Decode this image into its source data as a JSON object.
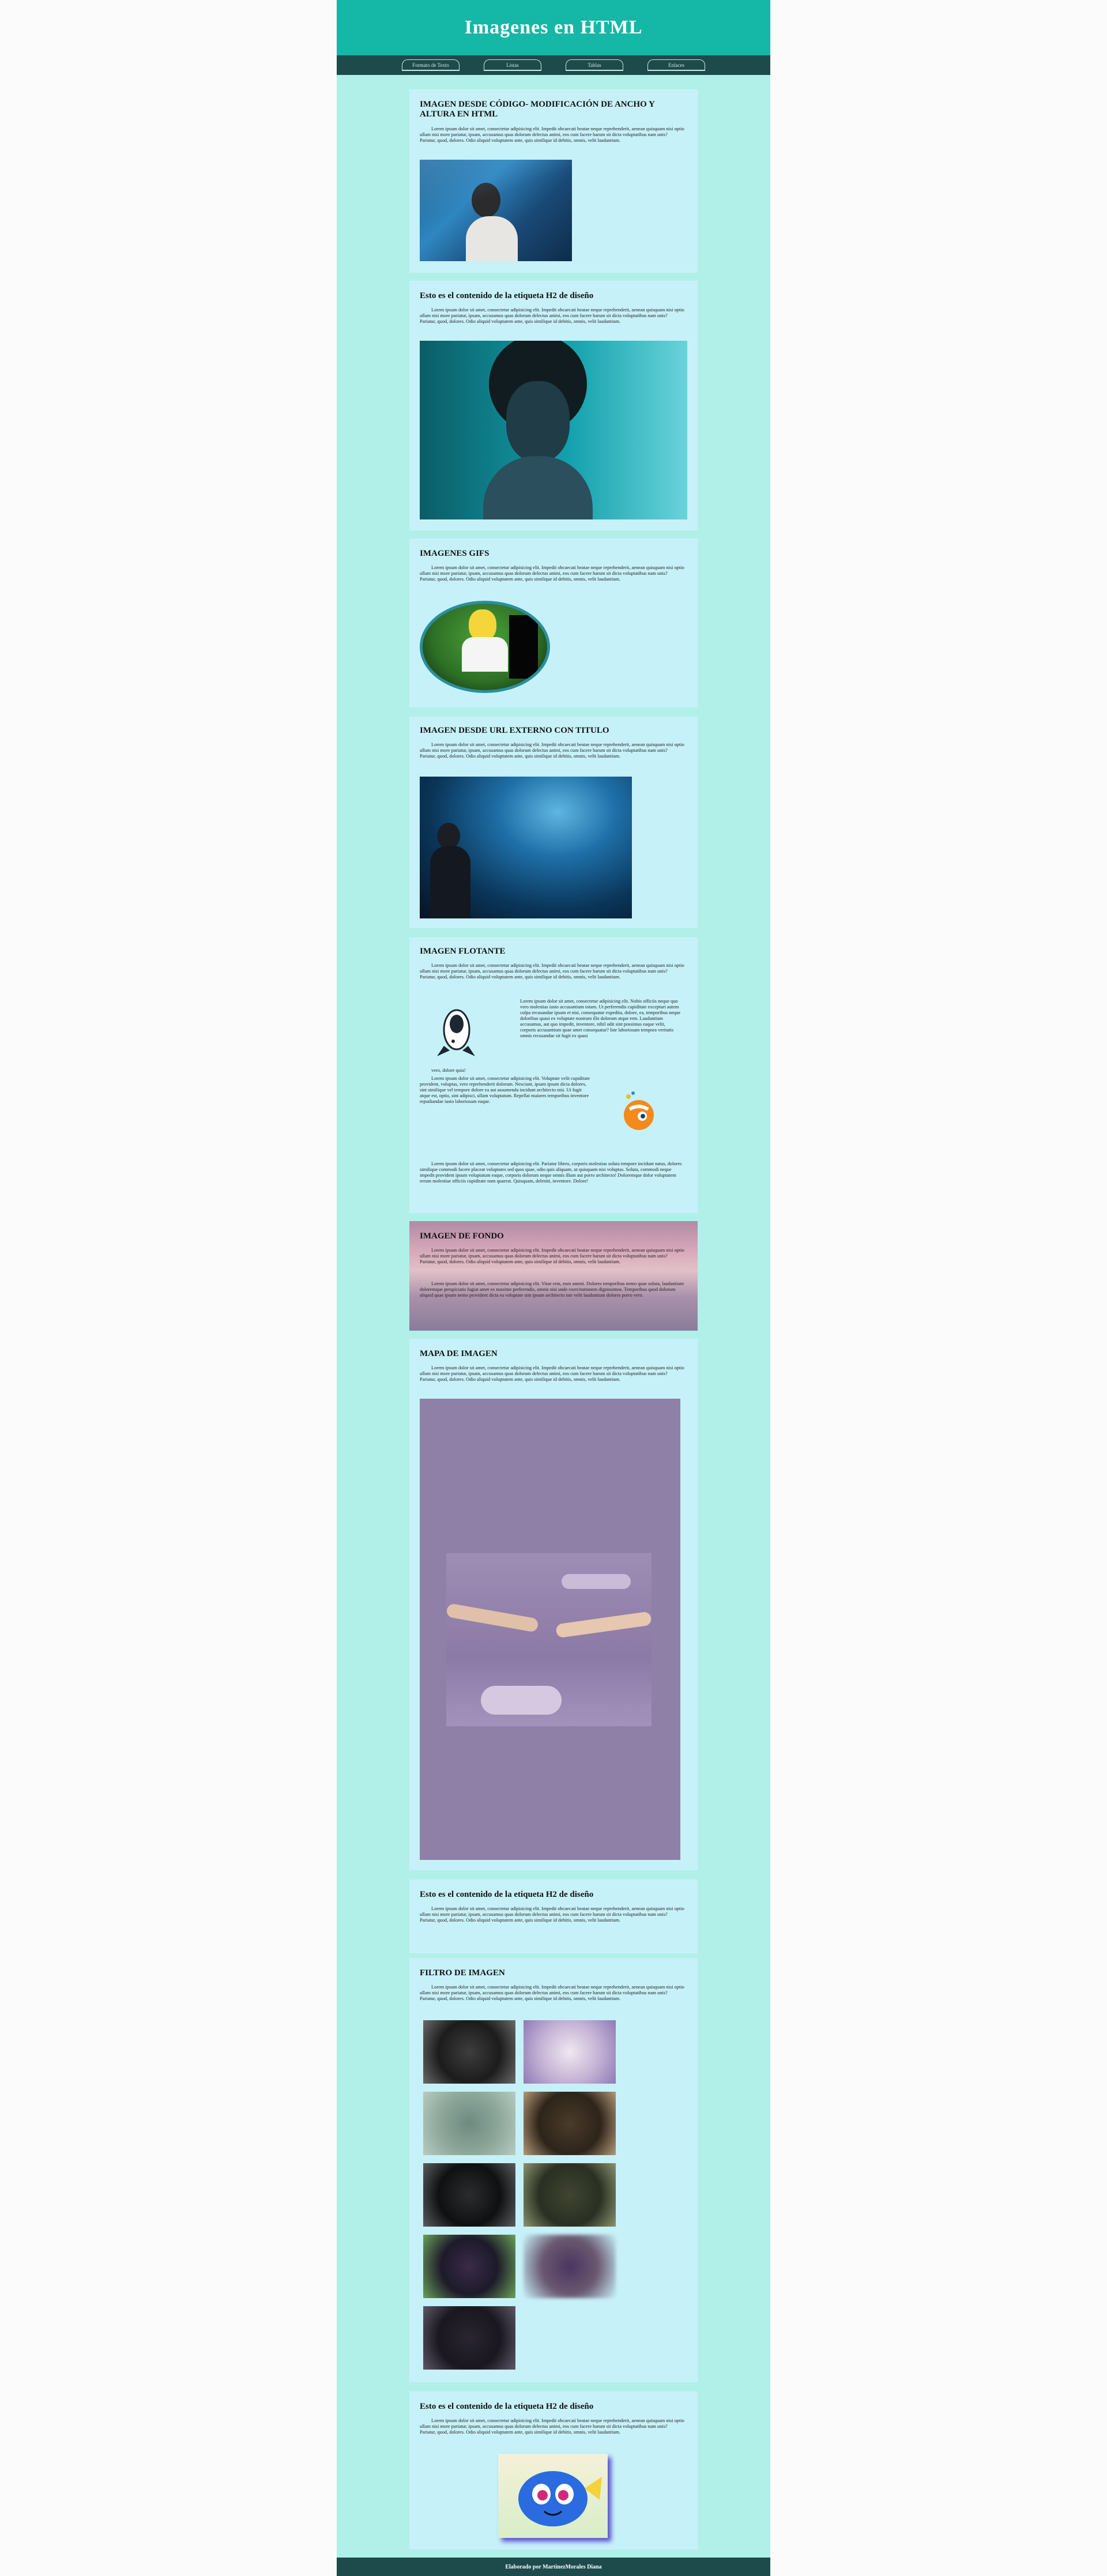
{
  "header": {
    "title": "Imagenes en HTML"
  },
  "nav": {
    "items": [
      "Formato de Texto",
      "Listas",
      "Tablas",
      "Enlaces"
    ]
  },
  "sections": [
    {
      "title": "IMAGEN DESDE CÓDIGO- MODIFICACIÓN DE ANCHO Y ALTURA EN HTML",
      "text": "Lorem ipsum dolor sit amet, consectetur adipisicing elit. Impedit obcaecati beatae neque reprehenderit, aenean quisquam nisi optio ullam nisi more pariatur, ipsam, accusamus quas dolorum delectus animi, eos cum facere harum sit dicta voluptatibus nam unis? Pariatur, quod, dolores. Odio aliquid voluptatem ante, quis similique id debitis, omnis, velit laudantium."
    },
    {
      "title": "Esto es el contenido de la etiqueta H2 de diseño",
      "text": "Lorem ipsum dolor sit amet, consectetur adipisicing elit. Impedit obcaecati beatae neque reprehenderit, aenean quisquam nisi optio ullam nisi more pariatur, ipsam, accusamus quas dolorum delectus animi, eos cum facere harum sit dicta voluptatibus nam unis? Pariatur, quod, dolores. Odio aliquid voluptatem ante, quis similique id debitis, omnis, velit laudantium."
    },
    {
      "title": "IMAGENES GIFS",
      "text": "Lorem ipsum dolor sit amet, consectetur adipisicing elit. Impedit obcaecati beatae neque reprehenderit, aenean quisquam nisi optio ullam nisi more pariatur, ipsam, accusamus quas dolorum delectus animi, eos cum facere harum sit dicta voluptatibus nam unis? Pariatur, quod, dolores. Odio aliquid voluptatem ante, quis similique id debitis, omnis, velit laudantium."
    },
    {
      "title": "IMAGEN DESDE URL EXTERNO CON TITULO",
      "text": "Lorem ipsum dolor sit amet, consectetur adipisicing elit. Impedit obcaecati beatae neque reprehenderit, aenean quisquam nisi optio ullam nisi more pariatur, ipsam, accusamus quas dolorum delectus animi, eos cum facere harum sit dicta voluptatibus nam unis? Pariatur, quod, dolores. Odio aliquid voluptatem ante, quis similique id debitis, omnis, velit laudantium."
    },
    {
      "title": "IMAGEN FLOTANTE",
      "text": "Lorem ipsum dolor sit amet, consectetur adipisicing elit. Impedit obcaecati beatae neque reprehenderit, aenean quisquam nisi optio ullam nisi more pariatur, ipsam, accusamus quas dolorum delectus animi, eos cum facere harum sit dicta voluptatibus nam unis? Pariatur, quod, dolores. Odio aliquid voluptatem ante, quis similique id debitis, omnis, velit laudantium.",
      "float1": "Lorem ipsum dolor sit amet, consectetur adipisicing elit. Nobis officiis neque quo vero molestias iusto accusantium totam. Ut perferendis cupiditate excepturi autem culpa recusandae ipsam et nisi, consequatur expedita, dolore, ea, temporibus neque doloribus quasi ex voluptate nostrum illo dolorum atque rem. Laudantium accusamus, aut quo impedit, inventore, nihil odit sint possimus eaque velit, corporis accusantium quae amet consequatur? Iste laboriosam tempora veritatis omnis recusandae sit fugit ex quasi",
      "float1b": "vero, dolore quia!",
      "float2": "Lorem ipsum dolor sit amet, consectetur adipisicing elit. Voluptate velit cupiditate provident, voluptas, vero reprehenderit dolorum. Nesciunt, ipsam ipsum dicta dolores, sint similique vel tempore dolore ea aut assumenda incidunt architecto nisi. Ut fugit atque est, optio, sint adipisci, ullam voluptatum. Repellat maiores temporibus inventore repudiandae iusto laboriosam eaque.",
      "text3": "Lorem ipsum dolor sit amet, consectetur adipisicing elit. Pariatur libero, corporis molestias soluta tempore incidunt natus, dolores similique commodi facere placeat voluptates sed quos quae, odio quis aliquam, ut quisquam nisi voluptas. Soluta, commodi neque impedit provident ipsum voluptatum eaque, corporis dolorum neque omnis illum aut porro architecto! Doloremque dolor voluptatem rerum molestiae officiis cupiditate nam quaerat. Quisquam, deleniti, inventore. Dolore!"
    },
    {
      "title": "IMAGEN DE FONDO",
      "text": "Lorem ipsum dolor sit amet, consectetur adipisicing elit. Impedit obcaecati beatae neque reprehenderit, aenean quisquam nisi optio ullam nisi more pariatur, ipsam, accusamus quas dolorum delectus animi, eos cum facere harum sit dicta voluptatibus nam unis? Pariatur, quod, dolores. Odio aliquid voluptatem ante, quis similique id debitis, omnis, velit laudantium.",
      "text2": "Lorem ipsum dolor sit amet, consectetur adipisicing elit. Vitae rem, eum ameni. Dolores temporibus nemo quae soluta, laudantium doloremque perspiciatis fugiat amet ex maxime perferendis, omnis nisi unde exercitationem dignissimos. Temporibus quod dolorum aliquid quae ipsam nemo provident dicta ea voluptate sint ipsum architecto iste velit laudantium dolores porro vero."
    },
    {
      "title": "MAPA DE IMAGEN",
      "text": "Lorem ipsum dolor sit amet, consectetur adipisicing elit. Impedit obcaecati beatae neque reprehenderit, aenean quisquam nisi optio ullam nisi more pariatur, ipsam, accusamus quas dolorum delectus animi, eos cum facere harum sit dicta voluptatibus nam unis? Pariatur, quod, dolores. Odio aliquid voluptatem ante, quis similique id debitis, omnis, velit laudantium."
    },
    {
      "title": "Esto es el contenido de la etiqueta H2 de diseño",
      "text": "Lorem ipsum dolor sit amet, consectetur adipisicing elit. Impedit obcaecati beatae neque reprehenderit, aenean quisquam nisi optio ullam nisi more pariatur, ipsam, accusamus quas dolorum delectus animi, eos cum facere harum sit dicta voluptatibus nam unis? Pariatur, quod, dolores. Odio aliquid voluptatem ante, quis similique id debitis, omnis, velit laudantium."
    },
    {
      "title": "FILTRO DE IMAGEN",
      "text": "Lorem ipsum dolor sit amet, consectetur adipisicing elit. Impedit obcaecati beatae neque reprehenderit, aenean quisquam nisi optio ullam nisi more pariatur, ipsam, accusamus quas dolorum delectus animi, eos cum facere harum sit dicta voluptatibus nam unis? Pariatur, quod, dolores. Odio aliquid voluptatem ante, quis similique id debitis, omnis, velit laudantium."
    },
    {
      "title": "Esto es el contenido de la etiqueta H2 de diseño",
      "text": "Lorem ipsum dolor sit amet, consectetur adipisicing elit. Impedit obcaecati beatae neque reprehenderit, aenean quisquam nisi optio ullam nisi more pariatur, ipsam, accusamus quas dolorum delectus animi, eos cum facere harum sit dicta voluptatibus nam unis? Pariatur, quod, dolores. Odio aliquid voluptatem ante, quis similique id debitis, omnis, velit laudantium."
    }
  ],
  "footer": {
    "text": "Elaborado por MartinezMorales Diana"
  }
}
